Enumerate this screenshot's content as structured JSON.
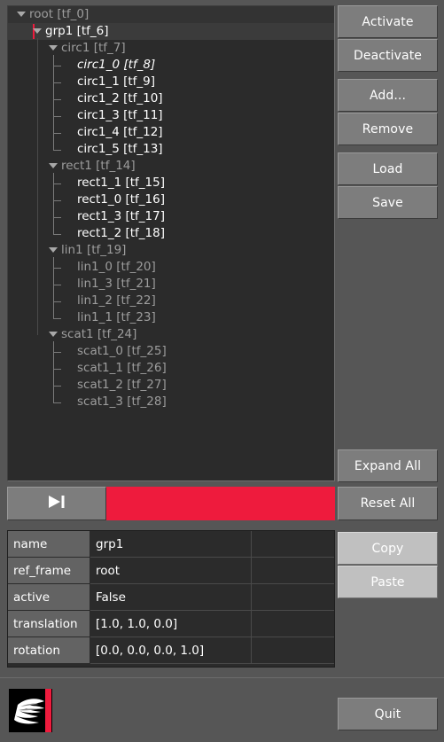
{
  "app": {
    "accent_red": "#ee1b3d",
    "panel_bg": "#2b2b2b",
    "frame_bg": "#565656"
  },
  "tree": {
    "nodes": [
      {
        "label": "root [tf_0]",
        "depth": 0,
        "arrow": true,
        "state": "header",
        "style": "dim"
      },
      {
        "label": "grp1 [tf_6]",
        "depth": 1,
        "arrow": true,
        "state": "selected",
        "style": "normal"
      },
      {
        "label": "circ1 [tf_7]",
        "depth": 2,
        "arrow": true,
        "state": "none",
        "style": "dim"
      },
      {
        "label": "circ1_0 [tf_8]",
        "depth": 3,
        "arrow": false,
        "state": "none",
        "style": "italic"
      },
      {
        "label": "circ1_1 [tf_9]",
        "depth": 3,
        "arrow": false,
        "state": "none",
        "style": "normal"
      },
      {
        "label": "circ1_2 [tf_10]",
        "depth": 3,
        "arrow": false,
        "state": "none",
        "style": "normal"
      },
      {
        "label": "circ1_3 [tf_11]",
        "depth": 3,
        "arrow": false,
        "state": "none",
        "style": "normal"
      },
      {
        "label": "circ1_4 [tf_12]",
        "depth": 3,
        "arrow": false,
        "state": "none",
        "style": "normal"
      },
      {
        "label": "circ1_5 [tf_13]",
        "depth": 3,
        "arrow": false,
        "state": "none",
        "style": "normal"
      },
      {
        "label": "rect1 [tf_14]",
        "depth": 2,
        "arrow": true,
        "state": "none",
        "style": "dim"
      },
      {
        "label": "rect1_1 [tf_15]",
        "depth": 3,
        "arrow": false,
        "state": "none",
        "style": "normal"
      },
      {
        "label": "rect1_0 [tf_16]",
        "depth": 3,
        "arrow": false,
        "state": "none",
        "style": "normal"
      },
      {
        "label": "rect1_3 [tf_17]",
        "depth": 3,
        "arrow": false,
        "state": "none",
        "style": "normal"
      },
      {
        "label": "rect1_2 [tf_18]",
        "depth": 3,
        "arrow": false,
        "state": "none",
        "style": "normal"
      },
      {
        "label": "lin1 [tf_19]",
        "depth": 2,
        "arrow": true,
        "state": "none",
        "style": "dim"
      },
      {
        "label": "lin1_0 [tf_20]",
        "depth": 3,
        "arrow": false,
        "state": "none",
        "style": "dim"
      },
      {
        "label": "lin1_3 [tf_21]",
        "depth": 3,
        "arrow": false,
        "state": "none",
        "style": "dim"
      },
      {
        "label": "lin1_2 [tf_22]",
        "depth": 3,
        "arrow": false,
        "state": "none",
        "style": "dim"
      },
      {
        "label": "lin1_1 [tf_23]",
        "depth": 3,
        "arrow": false,
        "state": "none",
        "style": "dim"
      },
      {
        "label": "scat1 [tf_24]",
        "depth": 2,
        "arrow": true,
        "state": "none",
        "style": "dim"
      },
      {
        "label": "scat1_0 [tf_25]",
        "depth": 3,
        "arrow": false,
        "state": "none",
        "style": "dim"
      },
      {
        "label": "scat1_1 [tf_26]",
        "depth": 3,
        "arrow": false,
        "state": "none",
        "style": "dim"
      },
      {
        "label": "scat1_2 [tf_27]",
        "depth": 3,
        "arrow": false,
        "state": "none",
        "style": "dim"
      },
      {
        "label": "scat1_3 [tf_28]",
        "depth": 3,
        "arrow": false,
        "state": "none",
        "style": "dim"
      }
    ]
  },
  "buttons": {
    "activate": "Activate",
    "deactivate": "Deactivate",
    "add": "Add...",
    "remove": "Remove",
    "load": "Load",
    "save": "Save",
    "expand_all": "Expand All",
    "reset_all": "Reset All",
    "copy": "Copy",
    "paste": "Paste",
    "quit": "Quit"
  },
  "transport": {
    "step_icon": "step-forward-icon",
    "progress_fill_percent": 100
  },
  "properties": {
    "rows": [
      {
        "key": "name",
        "value": "grp1"
      },
      {
        "key": "ref_frame",
        "value": "root"
      },
      {
        "key": "active",
        "value": "False"
      },
      {
        "key": "translation",
        "value": "[1.0, 1.0, 0.0]"
      },
      {
        "key": "rotation",
        "value": "[0.0, 0.0, 0.0, 1.0]"
      }
    ]
  },
  "footer": {
    "logo_icon": "bird-logo-icon"
  }
}
